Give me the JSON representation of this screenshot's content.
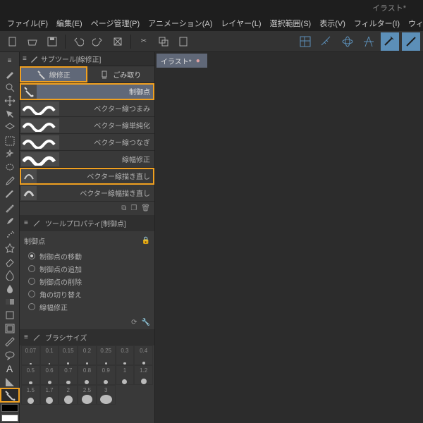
{
  "titlebar": {
    "title": "イラスト*"
  },
  "menubar": {
    "items": [
      "ファイル(F)",
      "編集(E)",
      "ページ管理(P)",
      "アニメーション(A)",
      "レイヤー(L)",
      "選択範囲(S)",
      "表示(V)",
      "フィルター(I)",
      "ウィンドウ(W)"
    ]
  },
  "canvas_tab": {
    "label": "イラスト*",
    "unsaved": "●"
  },
  "subtool_panel": {
    "header": "サブツール[線修正]",
    "tabs": [
      {
        "label": "線修正"
      },
      {
        "label": "ごみ取り"
      }
    ],
    "list": [
      {
        "label": "制御点",
        "selected": true,
        "highlighted": true,
        "wave": false
      },
      {
        "label": "ベクター線つまみ",
        "wave": true
      },
      {
        "label": "ベクター線単純化",
        "wave": true
      },
      {
        "label": "ベクター線つなぎ",
        "wave": true
      },
      {
        "label": "線幅修正",
        "wave": true
      },
      {
        "label": "ベクター線描き直し",
        "wave": false,
        "highlighted": true
      },
      {
        "label": "ベクター線幅描き直し",
        "wave": false
      }
    ]
  },
  "property_panel": {
    "header": "ツールプロパティ[制御点]",
    "title": "制御点",
    "options": [
      {
        "label": "制御点の移動",
        "checked": true
      },
      {
        "label": "制御点の追加",
        "checked": false
      },
      {
        "label": "制御点の削除",
        "checked": false
      },
      {
        "label": "角の切り替え",
        "checked": false
      },
      {
        "label": "線幅修正",
        "checked": false
      }
    ]
  },
  "brush_panel": {
    "header": "ブラシサイズ",
    "sizes": [
      0.07,
      0.1,
      0.15,
      0.2,
      0.25,
      0.3,
      0.4,
      0.5,
      0.6,
      0.7,
      0.8,
      0.9,
      1,
      1.2,
      1.5,
      1.7,
      2,
      2.5,
      3
    ]
  }
}
